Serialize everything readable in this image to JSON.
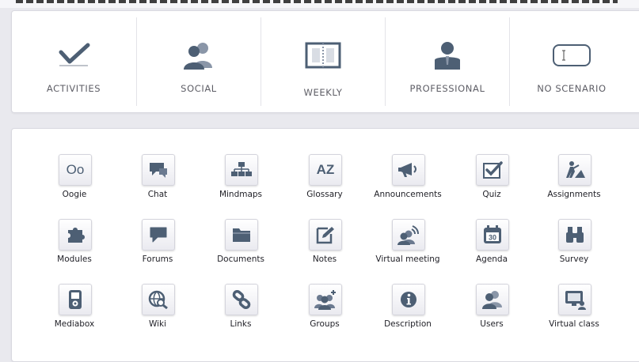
{
  "scenarios": [
    {
      "label": "ACTIVITIES",
      "icon": "checkmark-icon"
    },
    {
      "label": "SOCIAL",
      "icon": "people-icon"
    },
    {
      "label": "WEEKLY",
      "icon": "notebook-icon"
    },
    {
      "label": "PROFESSIONAL",
      "icon": "professional-person-icon"
    },
    {
      "label": "NO SCENARIO",
      "icon": "text-cursor-box-icon"
    }
  ],
  "tools": [
    {
      "label": "Oogie",
      "icon": "oogie-icon"
    },
    {
      "label": "Chat",
      "icon": "chat-icon"
    },
    {
      "label": "Mindmaps",
      "icon": "mindmap-icon"
    },
    {
      "label": "Glossary",
      "icon": "az-icon"
    },
    {
      "label": "Announcements",
      "icon": "megaphone-icon"
    },
    {
      "label": "Quiz",
      "icon": "checkbox-icon"
    },
    {
      "label": "Assignments",
      "icon": "worker-icon"
    },
    {
      "label": "Modules",
      "icon": "puzzle-icon"
    },
    {
      "label": "Forums",
      "icon": "speech-bubble-icon"
    },
    {
      "label": "Documents",
      "icon": "folder-icon"
    },
    {
      "label": "Notes",
      "icon": "edit-note-icon"
    },
    {
      "label": "Virtual meeting",
      "icon": "broadcast-people-icon"
    },
    {
      "label": "Agenda",
      "icon": "calendar-icon"
    },
    {
      "label": "Survey",
      "icon": "binoculars-icon"
    },
    {
      "label": "Mediabox",
      "icon": "media-player-icon"
    },
    {
      "label": "Wiki",
      "icon": "globe-search-icon"
    },
    {
      "label": "Links",
      "icon": "link-icon"
    },
    {
      "label": "Groups",
      "icon": "group-add-icon"
    },
    {
      "label": "Description",
      "icon": "info-icon"
    },
    {
      "label": "Users",
      "icon": "users-icon"
    },
    {
      "label": "Virtual class",
      "icon": "monitor-user-icon"
    }
  ],
  "colors": {
    "icon": "#4d5f74",
    "panel": "#ffffff",
    "background": "#e9e9ee"
  }
}
